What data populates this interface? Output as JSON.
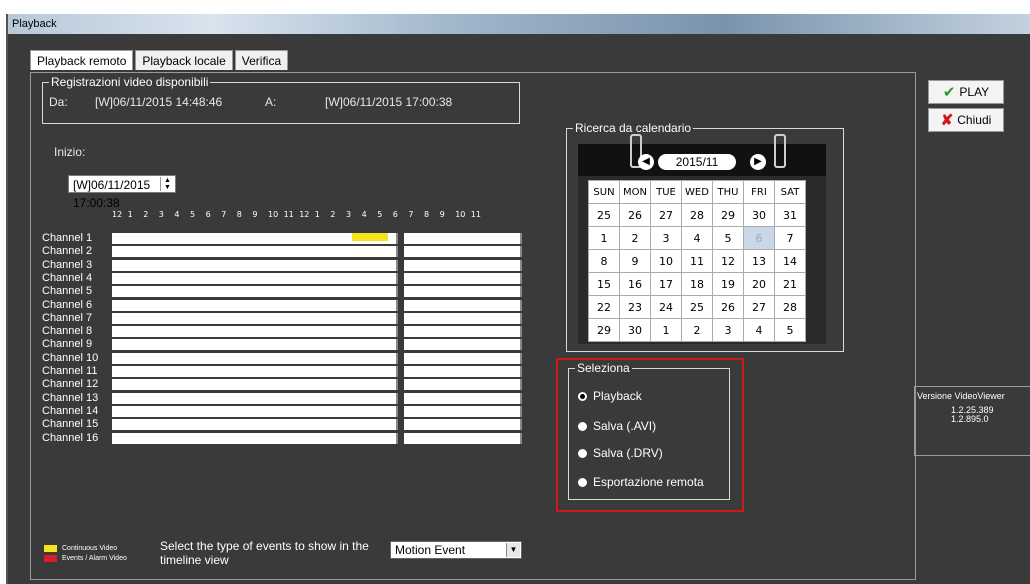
{
  "window": {
    "title": "Playback"
  },
  "tabs": [
    {
      "label": "Playback remoto",
      "active": true
    },
    {
      "label": "Playback locale",
      "active": false
    },
    {
      "label": "Verifica",
      "active": false
    }
  ],
  "recordings": {
    "group_title": "Registrazioni video disponibili",
    "from_label": "Da:",
    "from_value": "[W]06/11/2015 14:48:46",
    "to_label": "A:",
    "to_value": "[W]06/11/2015 17:00:38"
  },
  "start": {
    "label": "Inizio:",
    "value": "[W]06/11/2015 17:00:38"
  },
  "hours_a": [
    "12",
    "1",
    "2",
    "3",
    "4",
    "5",
    "6",
    "7",
    "8",
    "9",
    "10",
    "11"
  ],
  "hours_b": [
    "12",
    "1",
    "2",
    "3",
    "4",
    "5",
    "6",
    "7",
    "8",
    "9",
    "10",
    "11"
  ],
  "channels": [
    "Channel 1",
    "Channel 2",
    "Channel 3",
    "Channel 4",
    "Channel 5",
    "Channel 6",
    "Channel 7",
    "Channel 8",
    "Channel 9",
    "Channel 10",
    "Channel 11",
    "Channel 12",
    "Channel 13",
    "Channel 14",
    "Channel 15",
    "Channel 16"
  ],
  "calendar": {
    "group_title": "Ricerca da calendario",
    "month": "2015/11",
    "weekdays": [
      "SUN",
      "MON",
      "TUE",
      "WED",
      "THU",
      "FRI",
      "SAT"
    ],
    "weeks": [
      [
        "25",
        "26",
        "27",
        "28",
        "29",
        "30",
        "31"
      ],
      [
        "1",
        "2",
        "3",
        "4",
        "5",
        "6",
        "7"
      ],
      [
        "8",
        "9",
        "10",
        "11",
        "12",
        "13",
        "14"
      ],
      [
        "15",
        "16",
        "17",
        "18",
        "19",
        "20",
        "21"
      ],
      [
        "22",
        "23",
        "24",
        "25",
        "26",
        "27",
        "28"
      ],
      [
        "29",
        "30",
        "1",
        "2",
        "3",
        "4",
        "5"
      ]
    ],
    "selected_day": "6"
  },
  "seleziona": {
    "group_title": "Seleziona",
    "options": [
      {
        "label": "Playback",
        "checked": true
      },
      {
        "label": "Salva (.AVI)",
        "checked": false
      },
      {
        "label": "Salva (.DRV)",
        "checked": false
      },
      {
        "label": "Esportazione remota",
        "checked": false
      }
    ]
  },
  "buttons": {
    "play": "PLAY",
    "close": "Chiudi"
  },
  "version": {
    "title": "Versione VideoViewer",
    "lines": [
      "1.2.25.389",
      "1.2.895.0"
    ]
  },
  "legend": {
    "continuous": "Continuous Video",
    "events": "Events / Alarm Video"
  },
  "event_filter": {
    "label": "Select the type of events to show in the timeline view",
    "selected": "Motion Event"
  },
  "colors": {
    "continuous": "#f4e41c",
    "events": "#d81c2c",
    "highlight": "#d01818"
  }
}
